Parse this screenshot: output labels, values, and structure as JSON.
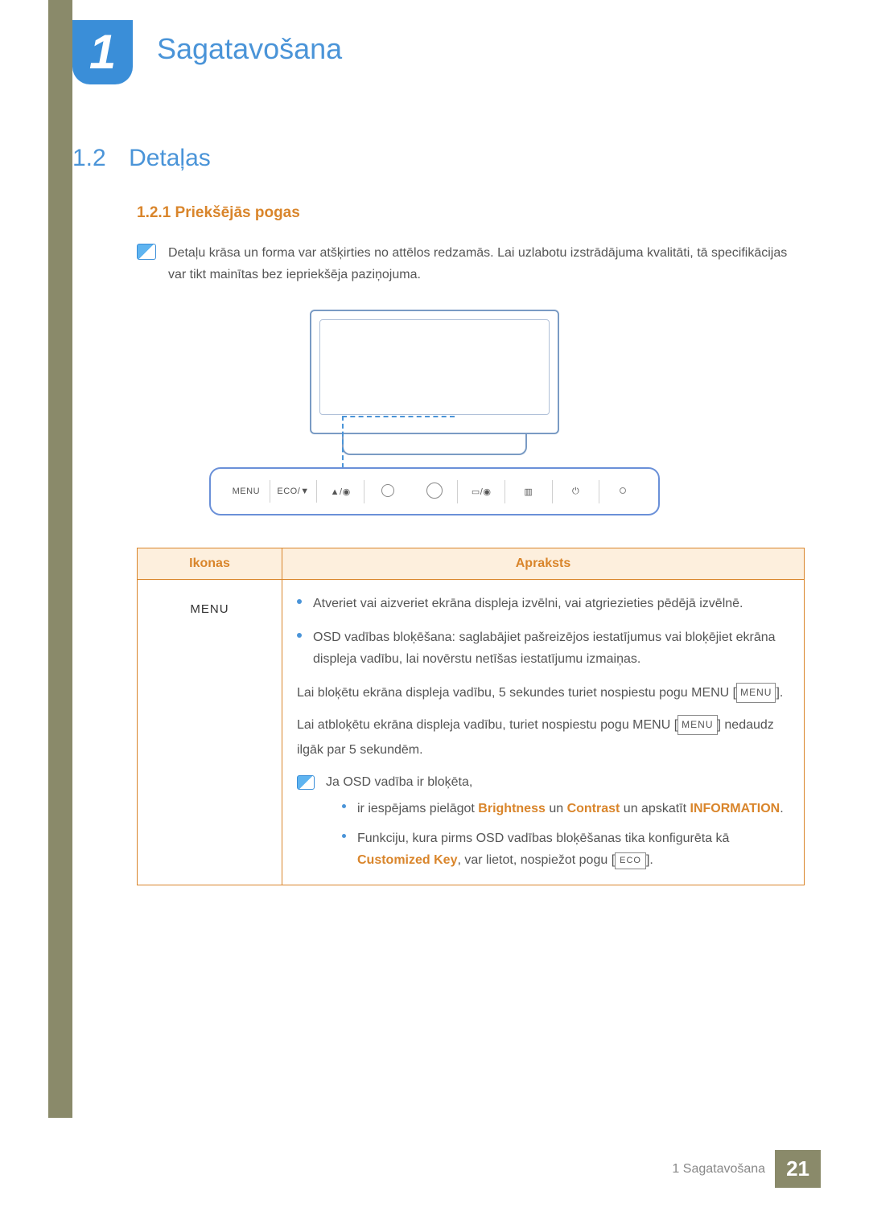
{
  "chapter": {
    "number": "1",
    "title": "Sagatavošana"
  },
  "section": {
    "number": "1.2",
    "title": "Detaļas"
  },
  "subsection": {
    "number": "1.2.1",
    "title": "Priekšējās pogas"
  },
  "note": "Detaļu krāsa un forma var atšķirties no attēlos redzamās. Lai uzlabotu izstrādājuma kvalitāti, tā specifikācijas var tikt mainītas bez iepriekšēja paziņojuma.",
  "buttons": {
    "menu": "MENU",
    "eco": "ECO/▼",
    "up": "▲/◉",
    "src": "▭/◉",
    "auto": "▥",
    "power": "⏻"
  },
  "table": {
    "header_icons": "Ikonas",
    "header_desc": "Apraksts",
    "row1_icon": "MENU",
    "b1": "Atveriet vai aizveriet ekrāna displeja izvēlni, vai atgriezieties pēdējā izvēlnē.",
    "b2": "OSD vadības bloķēšana: saglabājiet pašreizējos iestatījumus vai bloķējiet ekrāna displeja vadību, lai novērstu netīšas iestatījumu izmaiņas.",
    "p1a": "Lai bloķētu ekrāna displeja vadību, 5 sekundes turiet nospiestu pogu MENU [",
    "p1_menu": "MENU",
    "p1c": "].",
    "p2a": "Lai atbloķētu ekrāna displeja vadību, turiet nospiestu pogu MENU [",
    "p2_menu": "MENU",
    "p2c": "] nedaudz ilgāk par 5 sekundēm.",
    "inner_note_lead": "Ja OSD vadība ir bloķēta,",
    "sb1_a": "ir iespējams pielāgot ",
    "sb1_b": "Brightness",
    "sb1_c": " un ",
    "sb1_d": "Contrast",
    "sb1_e": " un apskatīt ",
    "sb1_f": "INFORMATION",
    "sb1_g": ".",
    "sb2_a": "Funkciju, kura pirms OSD vadības bloķēšanas tika konfigurēta kā ",
    "sb2_b": "Customized Key",
    "sb2_c": ", var lietot, nospiežot pogu [",
    "sb2_eco": "ECO",
    "sb2_d": "]."
  },
  "footer": {
    "label": "1 Sagatavošana",
    "page": "21"
  }
}
